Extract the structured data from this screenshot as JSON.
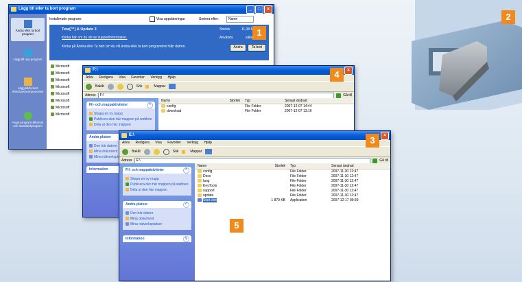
{
  "back_window": {
    "title": "Lägg till eller ta bort program",
    "side_items": [
      {
        "label": "Ändra eller ta bort program"
      },
      {
        "label": "Lägg till nya program"
      },
      {
        "label": "Lägg till/ta bort Windows-komponenter"
      },
      {
        "label": "Ange program-åtkomst och standardprogram"
      }
    ],
    "installed_label": "Installerade program:",
    "show_updates_label": "Visa uppdateringar",
    "sort_label": "Sortera efter:",
    "sort_value": "Namn",
    "selected_program": "Tera[™] & Update 3",
    "selected_size_label": "Storlek",
    "selected_size_value": "11,38 MB",
    "support_link": "Klicka här om du vill se supportinformation.",
    "used_label": "Används",
    "used_value": "sällan",
    "change_text": "Klicka på Ändra eller Ta bort om du vill ändra eller ta bort programmet från datorn.",
    "change_button": "Ändra",
    "remove_button": "Ta bort",
    "program_items": [
      "Microsoft",
      "Microsoft",
      "Microsoft",
      "Microsoft",
      "Microsoft",
      "Microsoft",
      "Microsoft",
      "Microsoft"
    ]
  },
  "mid_window": {
    "title": "F:\\",
    "menu": [
      "Arkiv",
      "Redigera",
      "Visa",
      "Favoriter",
      "Verktyg",
      "Hjälp"
    ],
    "toolbar": {
      "back": "Bakåt",
      "search": "Sök",
      "folders": "Mappar"
    },
    "address_label": "Adress",
    "address_value": "F:\\",
    "go_label": "Gå till",
    "tasks_title": "Fil- och mappaktiviteter",
    "tasks": [
      "Skapa en ny mapp",
      "Publicera den här mappen på webben",
      "Dela ut den här mappen"
    ],
    "places_title": "Andra platser",
    "places": [
      "Den här datorn",
      "Mina dokument",
      "Mina nätverksplatser"
    ],
    "info_title": "Information",
    "columns": {
      "name": "Namn",
      "size": "Storlek",
      "type": "Typ",
      "modified": "Senast ändrad"
    },
    "files": [
      {
        "name": "config",
        "size": "",
        "type": "File Folder",
        "modified": "2007-12-07 14:44"
      },
      {
        "name": "download",
        "size": "",
        "type": "File Folder",
        "modified": "2007-12-07 13:16"
      }
    ]
  },
  "front_window": {
    "title": "E:\\",
    "menu": [
      "Arkiv",
      "Redigera",
      "Visa",
      "Favoriter",
      "Verktyg",
      "Hjälp"
    ],
    "toolbar": {
      "back": "Bakåt",
      "search": "Sök",
      "folders": "Mappar"
    },
    "address_label": "Adress",
    "address_value": "E:\\",
    "go_label": "Gå till",
    "tasks_title": "Fil- och mappaktiviteter",
    "tasks": [
      "Skapa en ny mapp",
      "Publicera den här mappen på webben",
      "Dela ut den här mappen"
    ],
    "places_title": "Andra platser",
    "places": [
      "Den här datorn",
      "Mina dokument",
      "Mina nätverksplatser"
    ],
    "info_title": "Information",
    "columns": {
      "name": "Namn",
      "size": "Storlek",
      "type": "Typ",
      "modified": "Senast ändrad"
    },
    "files": [
      {
        "name": "config",
        "size": "",
        "type": "File Folder",
        "modified": "2007-11-30 12:47",
        "kind": "folder"
      },
      {
        "name": "Docs",
        "size": "",
        "type": "File Folder",
        "modified": "2007-11-30 12:47",
        "kind": "folder"
      },
      {
        "name": "lang",
        "size": "",
        "type": "File Folder",
        "modified": "2007-11-30 12:47",
        "kind": "folder"
      },
      {
        "name": "KeyTools",
        "size": "",
        "type": "File Folder",
        "modified": "2007-11-30 12:47",
        "kind": "folder"
      },
      {
        "name": "support",
        "size": "",
        "type": "File Folder",
        "modified": "2007-11-30 12:47",
        "kind": "folder"
      },
      {
        "name": "update",
        "size": "",
        "type": "File Folder",
        "modified": "2007-11-30 12:47",
        "kind": "folder"
      },
      {
        "name": "Start.exe",
        "size": "1 879 KB",
        "type": "Application",
        "modified": "2007-12-17 09:39",
        "kind": "app"
      }
    ]
  },
  "callouts": [
    "1",
    "2",
    "3",
    "4",
    "5"
  ],
  "colors": {
    "callout": "#f08a1c",
    "titlebar": "#0a5fd6",
    "selected_row": "#316ac5"
  }
}
